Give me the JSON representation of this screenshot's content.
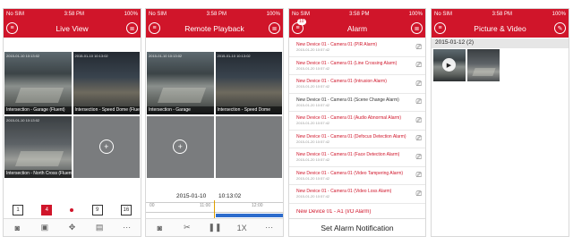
{
  "status": {
    "carrier": "No SIM",
    "time": "3:58 PM",
    "battery": "100%"
  },
  "live_view": {
    "title": "Live View",
    "tiles": [
      {
        "caption": "Intersection - Garage (Fluent)",
        "timestamp": "2015-01-10 10:13:02"
      },
      {
        "caption": "Intersection - Speed Dome (Fluent)",
        "timestamp": "2015-01-10 10:13:02"
      },
      {
        "caption": "Intersection - North Cross (Fluent)",
        "timestamp": "2015-01-10 10:13:02"
      },
      {
        "caption": ""
      }
    ],
    "modes": [
      "1",
      "4",
      "9",
      "16"
    ]
  },
  "remote_playback": {
    "title": "Remote Playback",
    "tiles": [
      {
        "caption": "Intersection - Garage",
        "timestamp": "2015-01-10 10:13:02"
      },
      {
        "caption": "Intersection - Speed Dome",
        "timestamp": "2015-01-10 10:13:02"
      }
    ],
    "date": "2015-01-10",
    "time": "10:13:02",
    "ticks": [
      "00",
      "11:00",
      "12:00"
    ],
    "speed": "1X"
  },
  "alarm": {
    "title": "Alarm",
    "badge": "10",
    "items": [
      {
        "title": "New Device 01 - Camera 01 (PIR Alarm)",
        "date": "2015-01-20 10:57:42"
      },
      {
        "title": "New Device 01 - Camera 01 (Line Crossing Alarm)",
        "date": "2015-01-20 10:57:42"
      },
      {
        "title": "New Device 01 - Camera 01 (Intrusion Alarm)",
        "date": "2015-01-20 10:57:42"
      },
      {
        "title": "New Device 01 - Camera 01 (Scene Change Alarm)",
        "date": "2015-01-20 10:57:42"
      },
      {
        "title": "New Device 01 - Camera 01 (Audio Abnormal Alarm)",
        "date": "2015-01-20 10:57:42"
      },
      {
        "title": "New Device 01 - Camera 01 (Defocus Detection Alarm)",
        "date": "2015-01-20 10:57:42"
      },
      {
        "title": "New Device 01 - Camera 01 (Face Detection Alarm)",
        "date": "2015-01-20 10:57:42"
      },
      {
        "title": "New Device 01 - Camera 01 (Video Tampering Alarm)",
        "date": "2015-01-20 10:57:42"
      },
      {
        "title": "New Device 01 - Camera 01 (Video Loss Alarm)",
        "date": "2015-01-20 10:57:42"
      },
      {
        "title": "New Device 01 - A1 (I/O Alarm)",
        "date": ""
      }
    ],
    "footer": "Set Alarm Notification"
  },
  "gallery": {
    "title": "Picture & Video",
    "group": "2015-01-12 (2)"
  },
  "colors": {
    "brand": "#d0152a",
    "accent": "#e8b020",
    "playback": "#2d6ccc"
  }
}
